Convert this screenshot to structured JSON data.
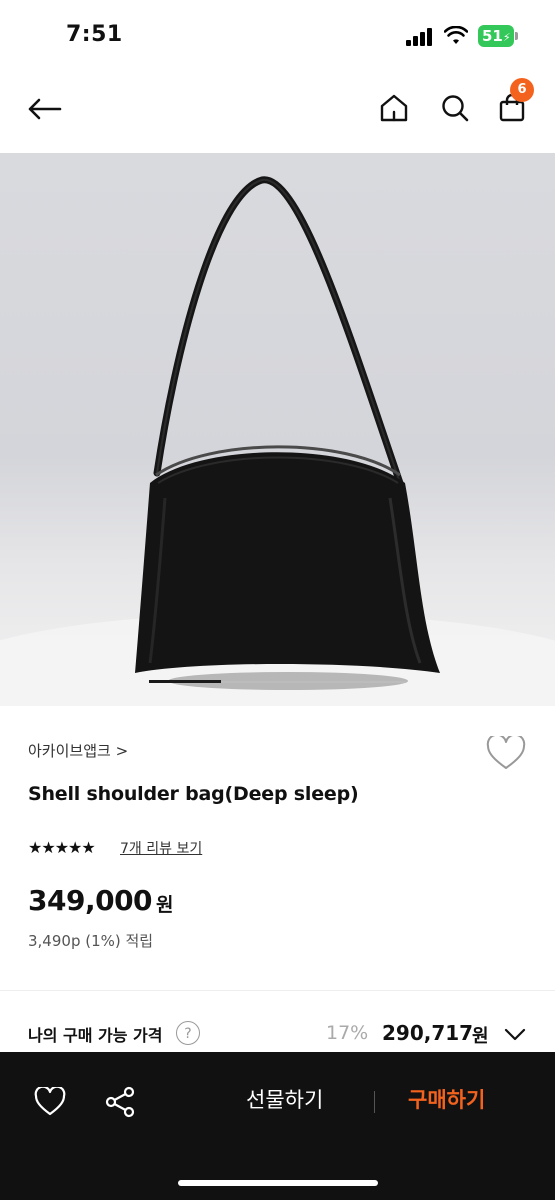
{
  "status_bar": {
    "time": "7:51",
    "battery": "51"
  },
  "nav": {
    "back_icon": "arrow-left-icon",
    "home_icon": "home-icon",
    "search_icon": "search-icon",
    "cart_icon": "shopping-bag-icon",
    "cart_count": "6",
    "badge_color": "#f4631e"
  },
  "gallery": {
    "image_subject": "black leather shoulder bag",
    "progress": 0.28
  },
  "product": {
    "brand": "아카이브앱크 >",
    "title": "Shell shoulder bag(Deep sleep)",
    "rating_stars": "★★★★★",
    "rating": 4.5,
    "review_link": "7개 리뷰 보기",
    "price": "349,000",
    "price_unit": "원",
    "points": "3,490p (1%) 적립",
    "wishlist_icon": "heart-outline-icon"
  },
  "my_price": {
    "label": "나의 구매 가능 가격",
    "help": "?",
    "discount": "17%",
    "price": "290,717",
    "unit": "원"
  },
  "bottom_bar": {
    "gift_label": "선물하기",
    "buy_label": "구매하기",
    "accent": "#f4631e"
  }
}
